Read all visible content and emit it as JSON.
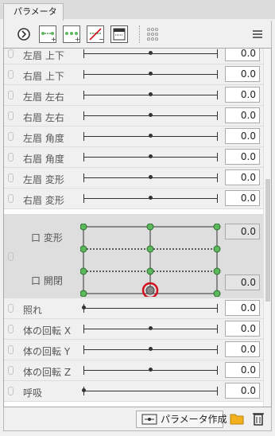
{
  "panel": {
    "tab_title": "パラメータ"
  },
  "toolbar": {
    "icons": [
      "circle-chevron-icon",
      "add-key-icon",
      "add-key-plus-icon",
      "delete-key-icon",
      "window-icon",
      "grid-dots-icon",
      "hamburger-menu-icon"
    ]
  },
  "parameters": [
    {
      "label": "左眉 上下",
      "value": "0.0",
      "slider": 0.5
    },
    {
      "label": "右眉 上下",
      "value": "0.0",
      "slider": 0.5
    },
    {
      "label": "左眉 左右",
      "value": "0.0",
      "slider": 0.5
    },
    {
      "label": "右眉 左右",
      "value": "0.0",
      "slider": 0.5
    },
    {
      "label": "左眉 角度",
      "value": "0.0",
      "slider": 0.5
    },
    {
      "label": "右眉 角度",
      "value": "0.0",
      "slider": 0.5
    },
    {
      "label": "左眉 変形",
      "value": "0.0",
      "slider": 0.5
    },
    {
      "label": "右眉 変形",
      "value": "0.0",
      "slider": 0.5
    }
  ],
  "mouth_group": {
    "label_top": "口 変形",
    "label_bottom": "口 開閉",
    "value_top": "0.0",
    "value_bottom": "0.0",
    "cursor_x": 0.5,
    "cursor_y": 0
  },
  "parameters2": [
    {
      "label": "照れ",
      "value": "0.0",
      "slider": 0
    },
    {
      "label": "体の回転 X",
      "value": "0.0",
      "slider": 0.5
    },
    {
      "label": "体の回転 Y",
      "value": "0.0",
      "slider": 0.5
    },
    {
      "label": "体の回転 Z",
      "value": "0.0",
      "slider": 0.5
    },
    {
      "label": "呼吸",
      "value": "0.0",
      "slider": 0
    }
  ],
  "bottom": {
    "create_label": "パラメータ作成"
  },
  "colors": {
    "accent_green": "#5cb85c",
    "highlight_red": "#d0101c"
  }
}
